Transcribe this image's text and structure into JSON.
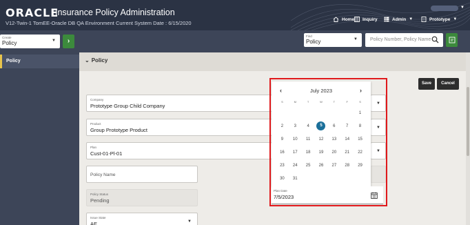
{
  "header": {
    "logo": "ORACLE",
    "title": "Insurance Policy Administration",
    "environment": "V12-Twin-1 TomEE-Oracle DB QA Environment",
    "system_date": "Current System Date : 6/15/2020",
    "nav": {
      "home": "Home",
      "inquiry": "Inquiry",
      "admin": "Admin",
      "prototype": "Prototype"
    }
  },
  "toolbar": {
    "create": {
      "label": "Create",
      "value": "Policy"
    },
    "find": {
      "label": "Find",
      "value": "Policy"
    },
    "search_placeholder": "Policy Number, Policy Name"
  },
  "sidebar": {
    "items": [
      {
        "label": "Policy"
      }
    ]
  },
  "panel": {
    "title": "Policy",
    "save_label": "Save",
    "cancel_label": "Cancel",
    "fields": {
      "company": {
        "label": "Company",
        "value": "Prototype Group Child Company"
      },
      "product": {
        "label": "Product",
        "value": "Group Prototype Product"
      },
      "plan": {
        "label": "Plan",
        "value": "Cust-01-Pl-01"
      },
      "policy_name": {
        "placeholder": "Policy Name"
      },
      "policy_status": {
        "label": "Policy Status",
        "value": "Pending"
      },
      "issue_state": {
        "label": "Issue State",
        "value": "AE"
      },
      "plan_date": {
        "label": "Plan Date",
        "value": "7/5/2023"
      }
    }
  },
  "calendar": {
    "month": "July 2023",
    "prev": "‹",
    "next": "›",
    "weekdays": [
      "S",
      "M",
      "T",
      "W",
      "T",
      "F",
      "S"
    ],
    "selected_day": 5,
    "accent_color": "#1b6f9a"
  }
}
